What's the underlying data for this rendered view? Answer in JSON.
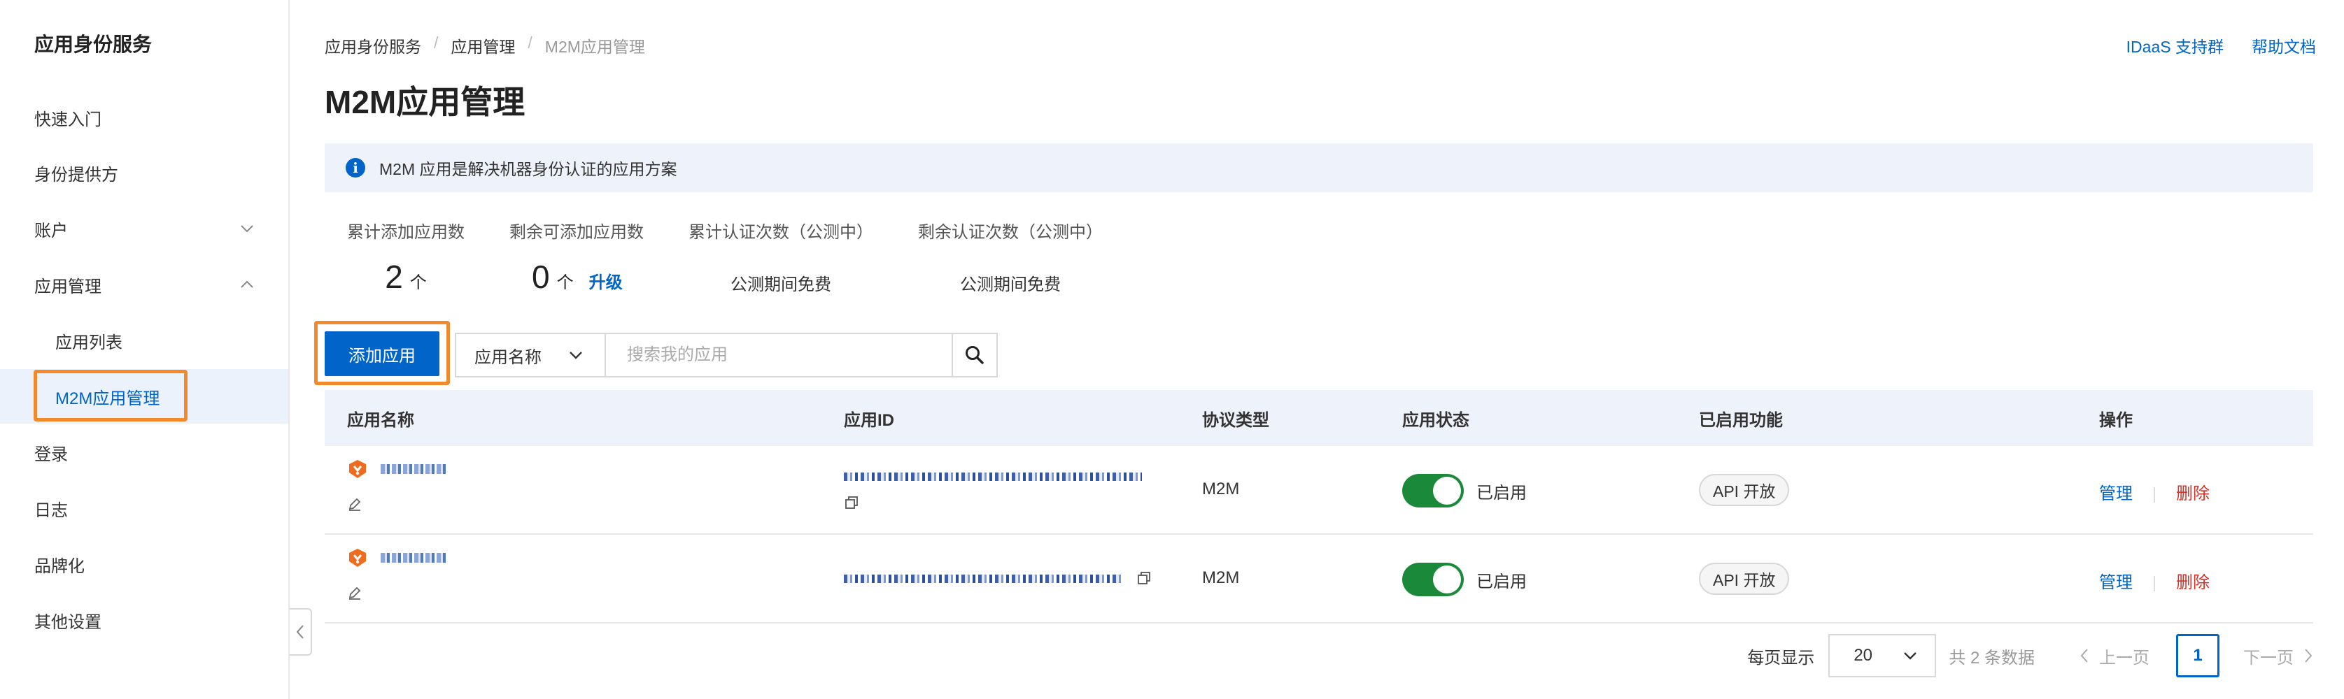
{
  "sidebar": {
    "title": "应用身份服务",
    "items": [
      {
        "label": "快速入门"
      },
      {
        "label": "身份提供方"
      },
      {
        "label": "账户"
      },
      {
        "label": "应用管理"
      },
      {
        "label": "应用列表"
      },
      {
        "label": "M2M应用管理"
      },
      {
        "label": "登录"
      },
      {
        "label": "日志"
      },
      {
        "label": "品牌化"
      },
      {
        "label": "其他设置"
      }
    ]
  },
  "breadcrumb": [
    "应用身份服务",
    "应用管理",
    "M2M应用管理"
  ],
  "top_links": {
    "support": "IDaaS 支持群",
    "docs": "帮助文档"
  },
  "page_title": "M2M应用管理",
  "notice": "M2M 应用是解决机器身份认证的应用方案",
  "stats": [
    {
      "label": "累计添加应用数",
      "value": "2",
      "unit": "个"
    },
    {
      "label": "剩余可添加应用数",
      "value": "0",
      "unit": "个",
      "action": "升级"
    },
    {
      "label": "累计认证次数（公测中）",
      "text": "公测期间免费"
    },
    {
      "label": "剩余认证次数（公测中）",
      "text": "公测期间免费"
    }
  ],
  "toolbar": {
    "add_button": "添加应用",
    "filter_select": "应用名称",
    "search_placeholder": "搜索我的应用"
  },
  "table": {
    "headers": [
      "应用名称",
      "应用ID",
      "协议类型",
      "应用状态",
      "已启用功能",
      "操作"
    ],
    "rows": [
      {
        "protocol": "M2M",
        "status": "已启用",
        "feature": "API 开放",
        "manage": "管理",
        "delete": "删除"
      },
      {
        "protocol": "M2M",
        "status": "已启用",
        "feature": "API 开放",
        "manage": "管理",
        "delete": "删除"
      }
    ]
  },
  "pagination": {
    "per_page_label": "每页显示",
    "per_page": "20",
    "total": "共 2 条数据",
    "prev": "上一页",
    "current": "1",
    "next": "下一页"
  },
  "colors": {
    "primary": "#0064c8",
    "highlight": "#f08a2c",
    "toggle_on": "#1a8a3a",
    "danger": "#d93026"
  }
}
